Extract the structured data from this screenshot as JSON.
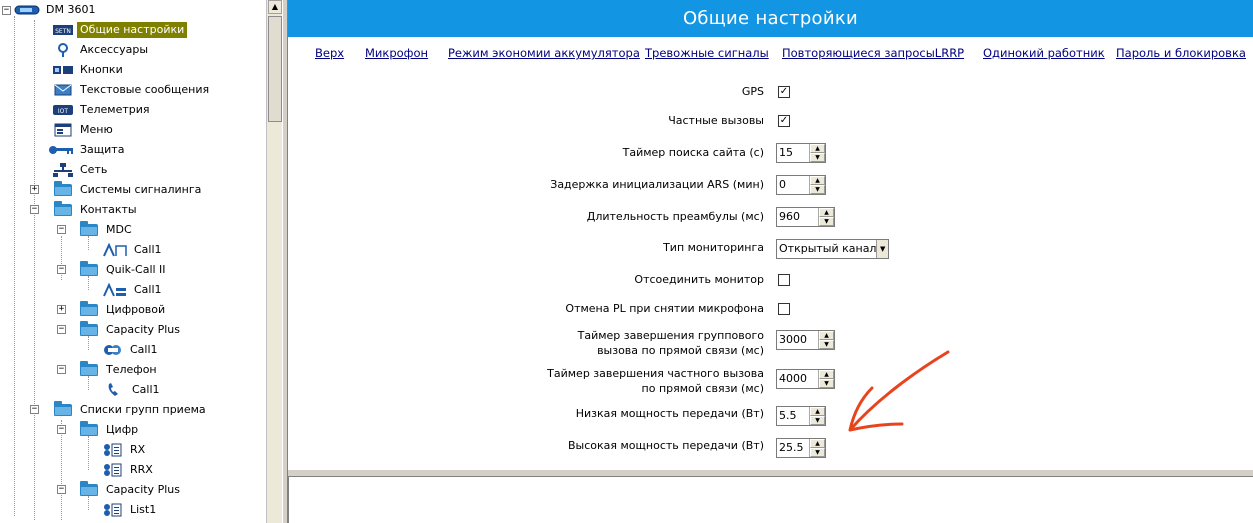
{
  "tree": {
    "root": "DM 3601",
    "items": [
      {
        "label": "Общие настройки",
        "icon": "settings-icon",
        "selected": true
      },
      {
        "label": "Аксессуары",
        "icon": "accessories-icon"
      },
      {
        "label": "Кнопки",
        "icon": "buttons-icon"
      },
      {
        "label": "Текстовые сообщения",
        "icon": "text-message-icon"
      },
      {
        "label": "Телеметрия",
        "icon": "telemetry-icon"
      },
      {
        "label": "Меню",
        "icon": "menu-icon"
      },
      {
        "label": "Защита",
        "icon": "key-icon"
      },
      {
        "label": "Сеть",
        "icon": "network-icon"
      },
      {
        "label": "Системы сигналинга",
        "icon": "folder-icon"
      },
      {
        "label": "Контакты",
        "icon": "folder-icon"
      },
      {
        "label": "MDC",
        "icon": "folder-icon"
      },
      {
        "label": "Call1",
        "icon": "mdc-call-icon"
      },
      {
        "label": "Quik-Call II",
        "icon": "folder-icon"
      },
      {
        "label": "Call1",
        "icon": "quikcall-icon"
      },
      {
        "label": "Цифровой",
        "icon": "folder-icon"
      },
      {
        "label": "Capacity Plus",
        "icon": "folder-icon"
      },
      {
        "label": "Call1",
        "icon": "capacity-call-icon"
      },
      {
        "label": "Телефон",
        "icon": "folder-icon"
      },
      {
        "label": "Call1",
        "icon": "phone-icon"
      },
      {
        "label": "Списки групп приема",
        "icon": "folder-icon"
      },
      {
        "label": "Цифр",
        "icon": "folder-icon"
      },
      {
        "label": "RX",
        "icon": "rx-list-icon"
      },
      {
        "label": "RRX",
        "icon": "rx-list-icon"
      },
      {
        "label": "Capacity Plus",
        "icon": "folder-icon"
      },
      {
        "label": "List1",
        "icon": "rx-list-icon"
      }
    ]
  },
  "main": {
    "title": "Общие настройки",
    "nav": [
      "Верх",
      "Микрофон",
      "Режим экономии аккумулятора",
      "Тревожные сигналы",
      "Повторяющиеся запросыLRRP",
      "Одинокий работник",
      "Пароль и блокировка"
    ],
    "fields": {
      "gps": {
        "label": "GPS",
        "checked": true
      },
      "private_calls": {
        "label": "Частные вызовы",
        "checked": true
      },
      "site_search_timer": {
        "label": "Таймер поиска сайта (с)",
        "value": "15"
      },
      "ars_init_delay": {
        "label": "Задержка инициализации ARS (мин)",
        "value": "0"
      },
      "preamble_duration": {
        "label": "Длительность преамбулы (мс)",
        "value": "960"
      },
      "monitor_type": {
        "label": "Тип мониторинга",
        "value": "Открытый канал"
      },
      "unmute_monitor": {
        "label": "Отсоединить монитор",
        "checked": false
      },
      "pl_cancel": {
        "label": "Отмена PL при снятии микрофона",
        "checked": false
      },
      "group_call_hang": {
        "label_1": "Таймер завершения группового",
        "label_2": "вызова по прямой связи (мс)",
        "value": "3000"
      },
      "private_call_hang": {
        "label_1": "Таймер завершения частного вызова",
        "label_2": "по прямой связи (мс)",
        "value": "4000"
      },
      "low_power": {
        "label": "Низкая мощность передачи (Вт)",
        "value": "5.5"
      },
      "high_power": {
        "label": "Высокая мощность передачи (Вт)",
        "value": "25.5"
      }
    },
    "check_mark": "✓",
    "annotation_color": "#e8431c"
  }
}
